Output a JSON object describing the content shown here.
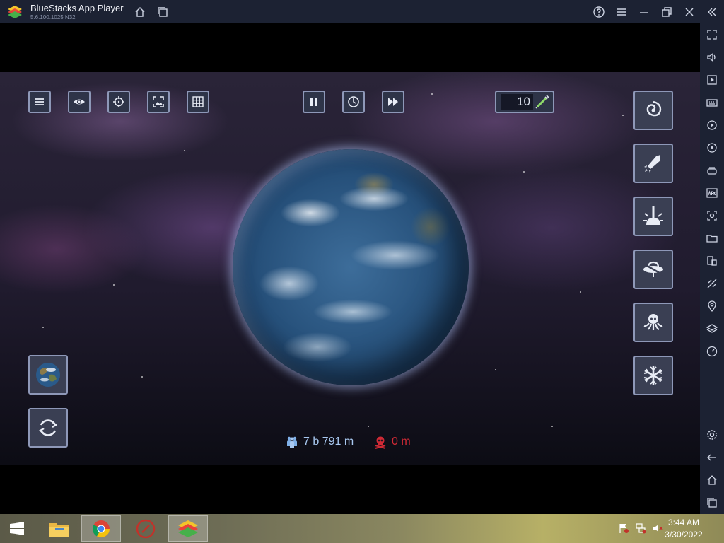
{
  "window": {
    "title": "BlueStacks App Player",
    "version": "5.6.100.1025  N32"
  },
  "title_controls": [
    "help-icon",
    "menu-icon",
    "minimize-icon",
    "restore-icon",
    "close-icon",
    "collapse-sidebar-icon"
  ],
  "title_nav": [
    "home-icon",
    "multi-instance-icon"
  ],
  "sidebar": {
    "items": [
      "fullscreen",
      "volume",
      "media",
      "keyboard",
      "macro",
      "rotate",
      "gamepad",
      "install-apk",
      "screenshot",
      "folder",
      "multi-window",
      "eco-mode",
      "location",
      "layers",
      "performance",
      "settings",
      "back",
      "home",
      "recent-apps"
    ]
  },
  "game": {
    "counter_value": "10",
    "population": "7 b 791 m",
    "deaths": "0 m",
    "colors": {
      "button_border": "#8e98b8",
      "population_text": "#a8c8f0",
      "deaths_text": "#d02a35"
    }
  },
  "taskbar": {
    "apps": [
      "start",
      "file-explorer",
      "chrome",
      "unknown-app",
      "bluestacks"
    ],
    "clock_time": "3:44 AM",
    "clock_date": "3/30/2022"
  }
}
